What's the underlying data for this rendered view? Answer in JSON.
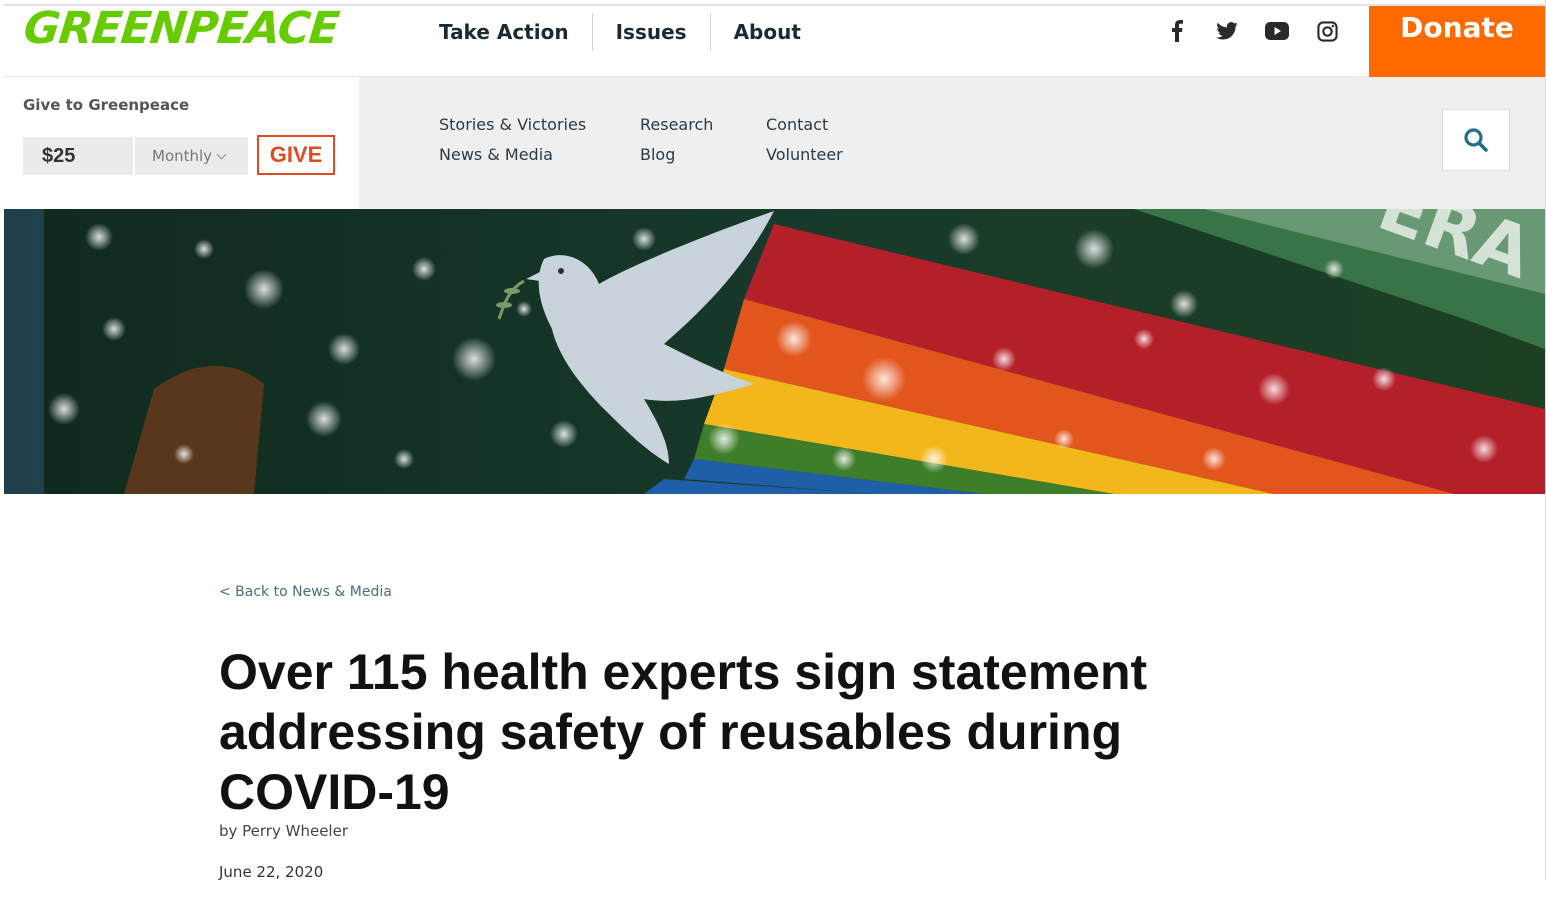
{
  "header": {
    "logo": "GREENPEACE",
    "nav": [
      "Take Action",
      "Issues",
      "About"
    ],
    "social_icons": [
      "facebook-icon",
      "twitter-icon",
      "youtube-icon",
      "instagram-icon"
    ],
    "donate_label": "Donate",
    "donate_color": "#ff6a00",
    "brand_color": "#66cc00"
  },
  "give": {
    "label": "Give to Greenpeace",
    "amount": "$25",
    "frequency": "Monthly",
    "button": "GIVE"
  },
  "subnav": {
    "items": [
      "Stories & Victories",
      "Research",
      "Contact",
      "News & Media",
      "Blog",
      "Volunteer"
    ]
  },
  "search": {
    "icon": "search-icon"
  },
  "hero": {
    "alt_icon": "peace-dove-rainbow-banner"
  },
  "article": {
    "back_link": "< Back to News & Media",
    "title": "Over 115 health experts sign statement addressing safety of reusables during COVID-19",
    "byline": "by Perry Wheeler",
    "date": "June 22, 2020"
  }
}
